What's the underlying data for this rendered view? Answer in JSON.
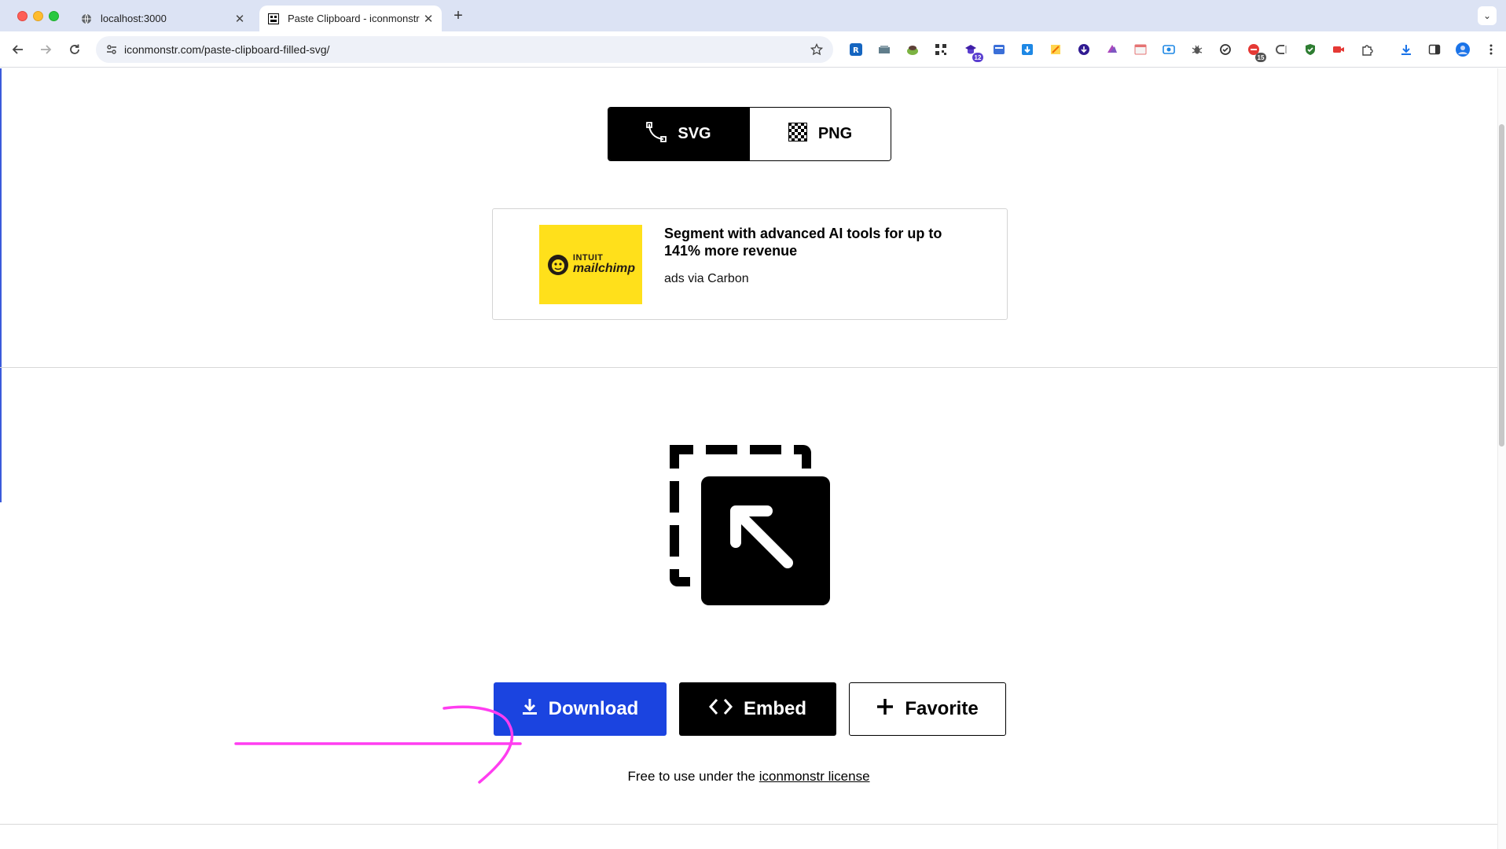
{
  "browser": {
    "tabs": [
      {
        "title": "localhost:3000",
        "active": false
      },
      {
        "title": "Paste Clipboard - iconmonstr",
        "active": true
      }
    ],
    "url": "iconmonstr.com/paste-clipboard-filled-svg/",
    "extension_badges": {
      "ext_5": "12",
      "ext_15": "15"
    }
  },
  "format_toggle": {
    "svg_label": "SVG",
    "png_label": "PNG",
    "selected": "SVG"
  },
  "ad": {
    "logo_top": "INTUIT",
    "logo_bottom": "mailchimp",
    "headline": "Segment with advanced AI tools for up to 141% more revenue",
    "via": "ads via Carbon",
    "image_color": "#ffe01b"
  },
  "icon": {
    "name": "paste-clipboard-filled"
  },
  "actions": {
    "download_label": "Download",
    "embed_label": "Embed",
    "favorite_label": "Favorite"
  },
  "license": {
    "prefix": "Free to use under the ",
    "link_text": "iconmonstr license"
  },
  "colors": {
    "download_button": "#1b44e0",
    "annotation_arrow": "#ff3df0"
  }
}
